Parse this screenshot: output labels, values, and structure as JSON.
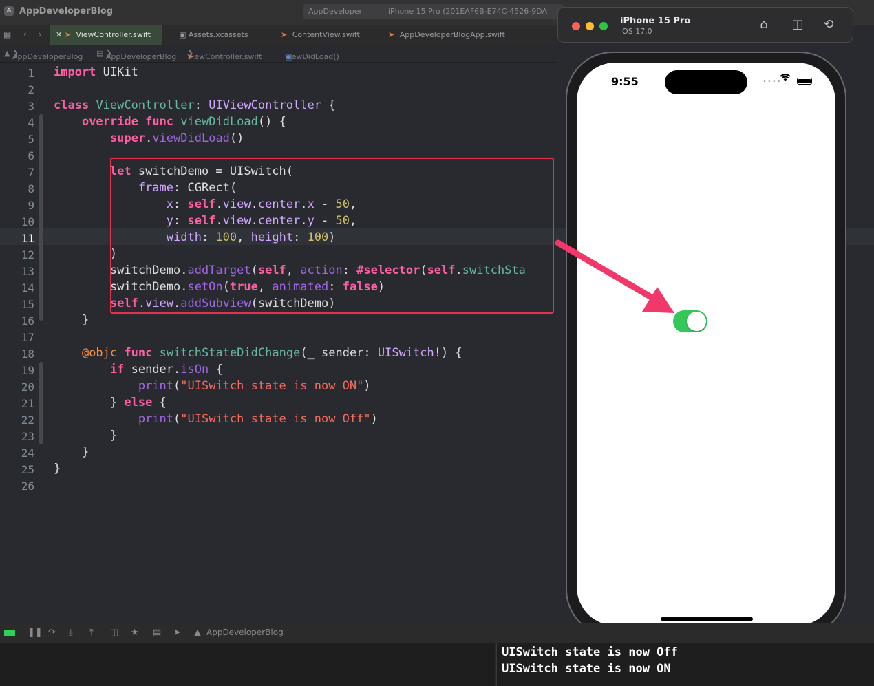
{
  "window": {
    "app_title": "AppDeveloperBlog",
    "scheme": "AppDeveloper",
    "destination": "iPhone 15 Pro (201EAF6B-E74C-4526-9DA"
  },
  "tabs": [
    {
      "label": "ViewController.swift"
    },
    {
      "label": "Assets.xcassets"
    },
    {
      "label": "ContentView.swift"
    },
    {
      "label": "AppDeveloperBlogApp.swift"
    }
  ],
  "breadcrumb": [
    "AppDeveloperBlog",
    "AppDeveloperBlog",
    "ViewController.swift",
    "viewDidLoad()"
  ],
  "editor": {
    "current_line": "11",
    "line_numbers": [
      "1",
      "2",
      "3",
      "4",
      "5",
      "6",
      "7",
      "8",
      "9",
      "10",
      "11",
      "12",
      "13",
      "14",
      "15",
      "16",
      "17",
      "18",
      "19",
      "20",
      "21",
      "22",
      "23",
      "24",
      "25",
      "26"
    ],
    "code": {
      "l1a": "import",
      "l1b": " UIKit",
      "l3a": "class",
      "l3b": " ",
      "l3c": "ViewController",
      "l3d": ": ",
      "l3e": "UIViewController",
      "l3f": " {",
      "l4a": "    ",
      "l4b": "override",
      "l4c": " ",
      "l4d": "func",
      "l4e": " ",
      "l4f": "viewDidLoad",
      "l4g": "() {",
      "l5a": "        ",
      "l5b": "super",
      "l5c": ".",
      "l5d": "viewDidLoad",
      "l5e": "()",
      "l7a": "        ",
      "l7b": "let",
      "l7c": " switchDemo = UISwitch(",
      "l8a": "            ",
      "l8b": "frame",
      "l8c": ": CGRect(",
      "l9a": "                ",
      "l9b": "x",
      "l9c": ": ",
      "l9d": "self",
      "l9e": ".",
      "l9f": "view",
      "l9g": ".",
      "l9h": "center",
      "l9i": ".",
      "l9j": "x",
      "l9k": " - ",
      "l9l": "50",
      "l9m": ",",
      "l10a": "                ",
      "l10b": "y",
      "l10c": ": ",
      "l10d": "self",
      "l10e": ".",
      "l10f": "view",
      "l10g": ".",
      "l10h": "center",
      "l10i": ".",
      "l10j": "y",
      "l10k": " - ",
      "l10l": "50",
      "l10m": ",",
      "l11a": "                ",
      "l11b": "width",
      "l11c": ": ",
      "l11d": "100",
      "l11e": ", ",
      "l11f": "height",
      "l11g": ": ",
      "l11h": "100",
      "l11i": ")",
      "l12a": "        )",
      "l13a": "        switchDemo.",
      "l13b": "addTarget",
      "l13c": "(",
      "l13d": "self",
      "l13e": ", ",
      "l13f": "action",
      "l13g": ": ",
      "l13h": "#selector",
      "l13i": "(",
      "l13j": "self",
      "l13k": ".",
      "l13l": "switchSta",
      "l14a": "        switchDemo.",
      "l14b": "setOn",
      "l14c": "(",
      "l14d": "true",
      "l14e": ", ",
      "l14f": "animated",
      "l14g": ": ",
      "l14h": "false",
      "l14i": ")",
      "l15a": "        ",
      "l15b": "self",
      "l15c": ".",
      "l15d": "view",
      "l15e": ".",
      "l15f": "addSubview",
      "l15g": "(switchDemo)",
      "l16a": "    }",
      "l18a": "    ",
      "l18b": "@objc",
      "l18c": " ",
      "l18d": "func",
      "l18e": " ",
      "l18f": "switchStateDidChange",
      "l18g": "(_ sender: ",
      "l18h": "UISwitch",
      "l18i": "!) {",
      "l19a": "        ",
      "l19b": "if",
      "l19c": " sender.",
      "l19d": "isOn",
      "l19e": " {",
      "l20a": "            ",
      "l20b": "print",
      "l20c": "(",
      "l20d": "\"UISwitch state is now ON\"",
      "l20e": ")",
      "l21a": "        } ",
      "l21b": "else",
      "l21c": " {",
      "l22a": "            ",
      "l22b": "print",
      "l22c": "(",
      "l22d": "\"UISwitch state is now Off\"",
      "l22e": ")",
      "l23a": "        }",
      "l24a": "    }",
      "l25a": "}"
    }
  },
  "simulator": {
    "device": "iPhone 15 Pro",
    "os": "iOS 17.0",
    "time": "9:55",
    "switch_on": true
  },
  "debug": {
    "target": "AppDeveloperBlog"
  },
  "console": {
    "lines": [
      "UISwitch state is now Off",
      "UISwitch state is now ON"
    ]
  },
  "colors": {
    "accent_switch": "#34c759",
    "annotation_red": "#e5334f",
    "arrow_pink": "#f0386b"
  }
}
